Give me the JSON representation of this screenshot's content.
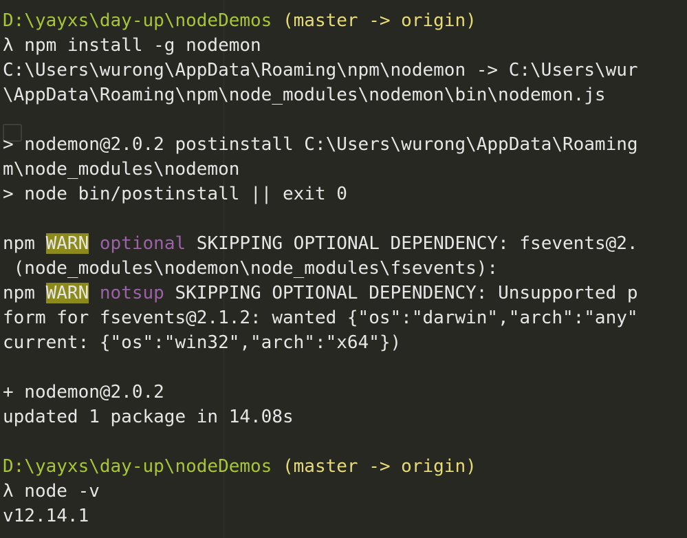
{
  "terminal": {
    "lines": [
      {
        "prompt_path": "D:\\yayxs\\day-up\\nodeDemos",
        "prompt_branch": " (master -> origin)"
      },
      {
        "text": "λ npm install -g nodemon"
      },
      {
        "text": "C:\\Users\\wurong\\AppData\\Roaming\\npm\\nodemon -> C:\\Users\\wur"
      },
      {
        "text": "\\AppData\\Roaming\\npm\\node_modules\\nodemon\\bin\\nodemon.js"
      },
      {
        "text": ""
      },
      {
        "text": "> nodemon@2.0.2 postinstall C:\\Users\\wurong\\AppData\\Roaming"
      },
      {
        "text": "m\\node_modules\\nodemon"
      },
      {
        "text": "> node bin/postinstall || exit 0"
      },
      {
        "text": ""
      },
      {
        "warn_prefix": "npm ",
        "warn_tag": "WARN",
        "warn_kind": " optional",
        "warn_rest": " SKIPPING OPTIONAL DEPENDENCY: fsevents@2."
      },
      {
        "text": " (node_modules\\nodemon\\node_modules\\fsevents):"
      },
      {
        "warn_prefix": "npm ",
        "warn_tag": "WARN",
        "warn_kind": " notsup",
        "warn_rest": " SKIPPING OPTIONAL DEPENDENCY: Unsupported p"
      },
      {
        "text": "form for fsevents@2.1.2: wanted {\"os\":\"darwin\",\"arch\":\"any\""
      },
      {
        "text": "current: {\"os\":\"win32\",\"arch\":\"x64\"})"
      },
      {
        "text": ""
      },
      {
        "text": "+ nodemon@2.0.2"
      },
      {
        "text": "updated 1 package in 14.08s"
      },
      {
        "text": ""
      },
      {
        "prompt_path": "D:\\yayxs\\day-up\\nodeDemos",
        "prompt_branch": " (master -> origin)"
      },
      {
        "text": "λ node -v"
      },
      {
        "text": "v12.14.1"
      }
    ]
  },
  "colors": {
    "background": "#272822",
    "path": "#a6c634",
    "branch": "#e6db74",
    "warn_bg": "#8d8a1c",
    "purple": "#9b62a8",
    "text": "#e6e6e6"
  }
}
